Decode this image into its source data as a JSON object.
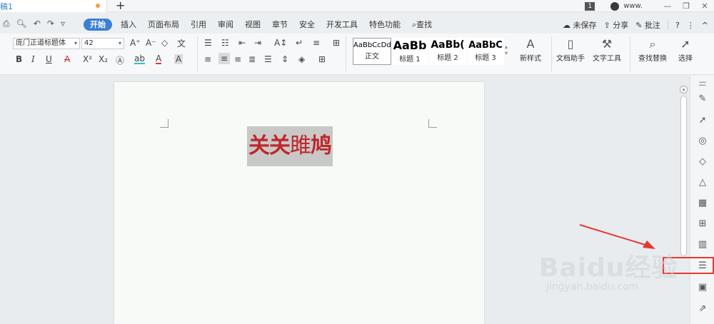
{
  "titlebar": {
    "doc_tab": "稿1",
    "new_tab": "+",
    "page_count": "1",
    "user_name": "www.",
    "minimize": "—",
    "restore": "❐",
    "close": "✕"
  },
  "menubar": {
    "items": [
      "开始",
      "插入",
      "页面布局",
      "引用",
      "审阅",
      "视图",
      "章节",
      "安全",
      "开发工具",
      "特色功能",
      "查找"
    ],
    "right": {
      "unsaved": "未保存",
      "share": "分享",
      "comment": "批注",
      "help": "?",
      "more": "⋮",
      "collapse": "^"
    }
  },
  "ribbon": {
    "font_name": "庞门正道标题体",
    "font_size": "42",
    "styles": [
      {
        "sample": "AaBbCcDd",
        "label": "正文"
      },
      {
        "sample": "AaBb",
        "label": "标题 1"
      },
      {
        "sample": "AaBb(",
        "label": "标题 2"
      },
      {
        "sample": "AaBbC",
        "label": "标题 3"
      }
    ],
    "new_style": "新样式",
    "doc_assistant": "文档助手",
    "text_tools": "文字工具",
    "find_replace": "查找替换",
    "select": "选择"
  },
  "document": {
    "heading_bold": "关关",
    "heading_light": "雎",
    "heading_bold2": "鸠"
  },
  "watermark": {
    "main": "Baidu经验",
    "sub": "jingyan.baidu.com"
  },
  "colors": {
    "accent": "#3b7fd6",
    "heading_red": "#c0262d",
    "annotation_red": "#e53935"
  }
}
